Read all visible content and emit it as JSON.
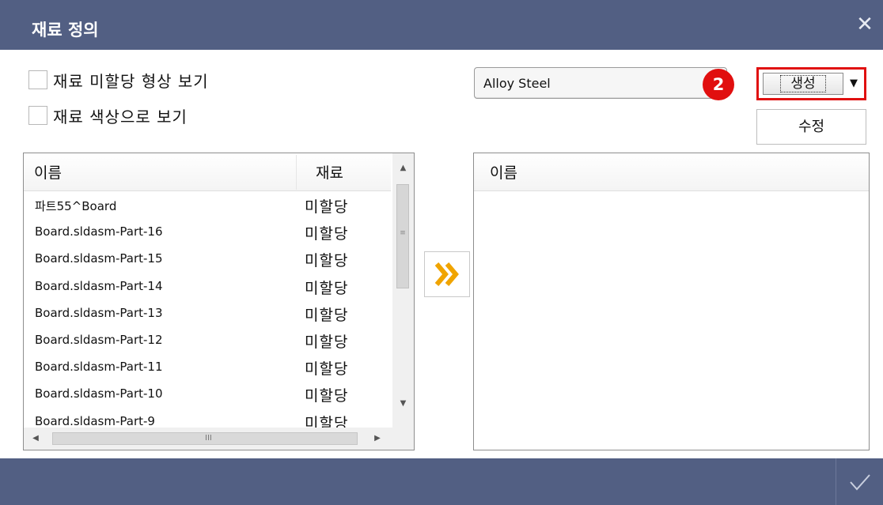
{
  "window": {
    "title": "재료 정의",
    "close_glyph": "✕"
  },
  "options": {
    "show_unassigned_label": "재료 미할당 형상 보기",
    "show_by_color_label": "재료 색상으로 보기"
  },
  "material_select": {
    "value": "Alloy Steel"
  },
  "step_badge": "2",
  "create_button": {
    "label": "생성",
    "dropdown_glyph": "▼"
  },
  "dropdown_menu": {
    "item": "수정"
  },
  "parts_list": {
    "columns": [
      "이름",
      "재료"
    ],
    "rows": [
      {
        "name": "파트55^Board",
        "material": "미할당"
      },
      {
        "name": "Board.sldasm-Part-16",
        "material": "미할당"
      },
      {
        "name": "Board.sldasm-Part-15",
        "material": "미할당"
      },
      {
        "name": "Board.sldasm-Part-14",
        "material": "미할당"
      },
      {
        "name": "Board.sldasm-Part-13",
        "material": "미할당"
      },
      {
        "name": "Board.sldasm-Part-12",
        "material": "미할당"
      },
      {
        "name": "Board.sldasm-Part-11",
        "material": "미할당"
      },
      {
        "name": "Board.sldasm-Part-10",
        "material": "미할당"
      },
      {
        "name": "Board.sldasm-Part-9",
        "material": "미할당"
      }
    ]
  },
  "assigned_list": {
    "columns": [
      "이름"
    ]
  },
  "icons": {
    "transfer": "double-chevron-right-icon",
    "confirm": "checkmark-icon",
    "close": "close-icon"
  },
  "colors": {
    "titlebar": "#525f83",
    "highlight": "#e01010",
    "transfer_arrow": "#f0a400"
  }
}
